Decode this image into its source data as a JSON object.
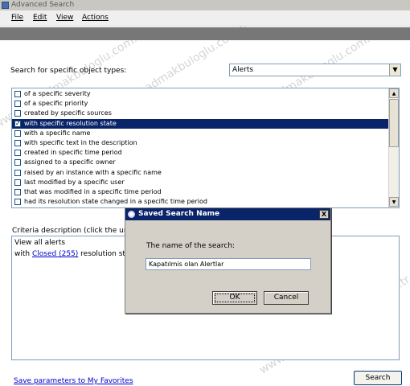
{
  "window": {
    "title": "Advanced Search"
  },
  "menu": [
    "File",
    "Edit",
    "View",
    "Actions"
  ],
  "search_types": {
    "label": "Search for specific object types:",
    "selected": "Alerts"
  },
  "criteria_list": [
    {
      "label": "of a specific severity",
      "checked": false,
      "selected": false
    },
    {
      "label": "of a specific priority",
      "checked": false,
      "selected": false
    },
    {
      "label": "created by specific sources",
      "checked": false,
      "selected": false
    },
    {
      "label": "with specific resolution state",
      "checked": true,
      "selected": true
    },
    {
      "label": "with a specific name",
      "checked": false,
      "selected": false
    },
    {
      "label": "with specific text in the description",
      "checked": false,
      "selected": false
    },
    {
      "label": "created in specific time period",
      "checked": false,
      "selected": false
    },
    {
      "label": "assigned to a specific owner",
      "checked": false,
      "selected": false
    },
    {
      "label": "raised by an instance with a specific name",
      "checked": false,
      "selected": false
    },
    {
      "label": "last modified by a specific user",
      "checked": false,
      "selected": false
    },
    {
      "label": "that was modified in a specific time period",
      "checked": false,
      "selected": false
    },
    {
      "label": "had its resolution state changed in a specific time period",
      "checked": false,
      "selected": false
    }
  ],
  "criteria_description": {
    "label": "Criteria description (click the underli",
    "line1": "View all alerts",
    "line2_prefix": "with",
    "line2_link": "Closed (255)",
    "line2_suffix": "resolution state"
  },
  "footer": {
    "favorites_link": "Save parameters to My Favorites",
    "search_button": "Search"
  },
  "dialog": {
    "title": "Saved Search Name",
    "close": "X",
    "prompt": "The name of the search:",
    "value": "Kapatılmis olan Alertlar",
    "ok": "OK",
    "cancel": "Cancel"
  },
  "watermark": "www.serhadmakbuloglu.com.tr",
  "colors": {
    "selection": "#0a246a",
    "link": "#0000cc",
    "dark_band": "#777777"
  }
}
